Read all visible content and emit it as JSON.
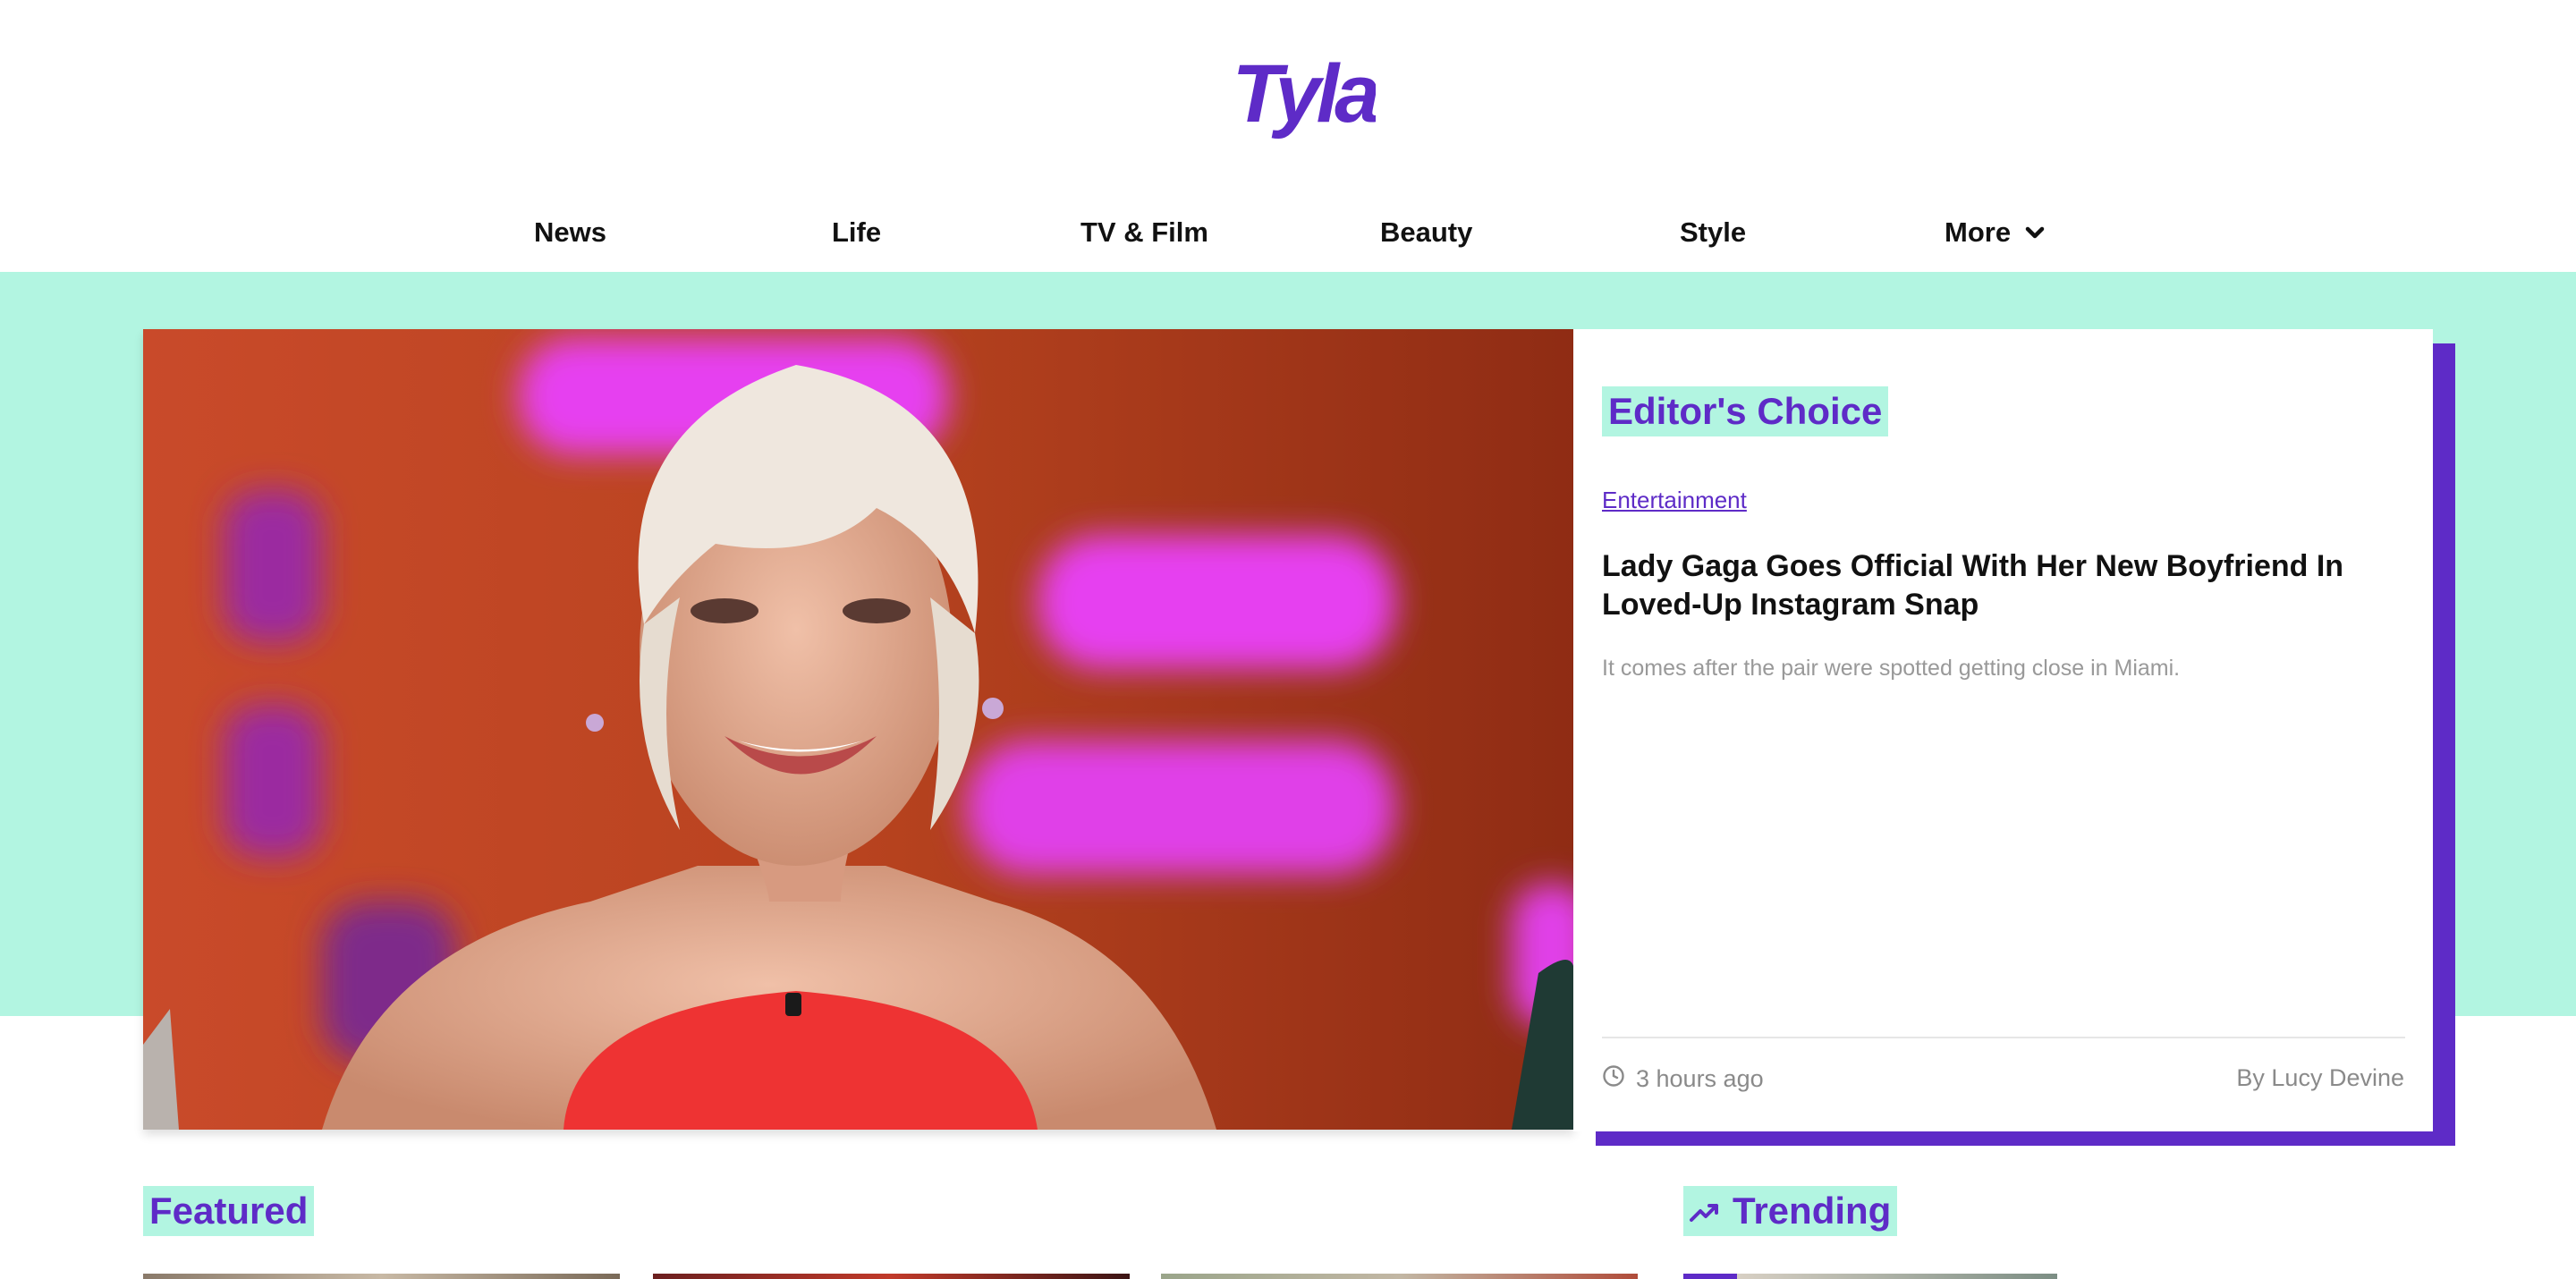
{
  "brand": {
    "logo_text": "Tyla",
    "color": "#5e2bc7"
  },
  "nav": {
    "items": [
      "News",
      "Life",
      "TV & Film",
      "Beauty",
      "Style",
      "More"
    ],
    "more_icon": "chevron-down-icon"
  },
  "hero": {
    "section_label": "Editor's Choice",
    "category": "Entertainment",
    "headline": "Lady Gaga Goes Official With Her New Boyfriend In Loved-Up Instagram Snap",
    "standfirst": "It comes after the pair were spotted getting close in Miami.",
    "time_icon": "clock-icon",
    "time": "3 hours ago",
    "author": "By Lucy Devine"
  },
  "sections": {
    "featured": "Featured",
    "trending": "Trending",
    "trending_icon": "trending-up-icon"
  },
  "colors": {
    "mint": "#b2f5e1",
    "purple": "#5e2bc7",
    "muted_text": "#999999"
  }
}
